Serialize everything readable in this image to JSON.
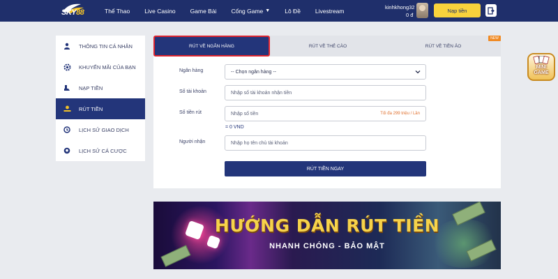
{
  "header": {
    "logo_text_a": "SKY",
    "logo_text_b": "88",
    "nav": [
      {
        "label": "Thể Thao"
      },
      {
        "label": "Live Casino"
      },
      {
        "label": "Game Bài"
      },
      {
        "label": "Cổng Game",
        "has_caret": true
      },
      {
        "label": "Lô Đề"
      },
      {
        "label": "Livestream"
      }
    ],
    "username": "kinhkhong32",
    "balance": "0 đ",
    "deposit_label": "Nạp tiền"
  },
  "sidebar": {
    "items": [
      {
        "label": "THÔNG TIN CÁ NHÂN",
        "icon": "user-icon"
      },
      {
        "label": "KHUYẾN MÃI CỦA BẠN",
        "icon": "gear-icon"
      },
      {
        "label": "NẠP TIỀN",
        "icon": "hand-coin-icon"
      },
      {
        "label": "RÚT TIỀN",
        "icon": "withdraw-icon",
        "active": true
      },
      {
        "label": "LỊCH SỬ GIAO DỊCH",
        "icon": "history-icon"
      },
      {
        "label": "LỊCH SỬ CÁ CƯỢC",
        "icon": "ball-icon"
      }
    ]
  },
  "tabs": [
    {
      "label": "RÚT VỀ NGÂN HÀNG",
      "active": true
    },
    {
      "label": "RÚT VỀ THẺ CÀO"
    },
    {
      "label": "RÚT VỀ TIỀN ẢO"
    }
  ],
  "new_badge": "NEW",
  "form": {
    "bank_label": "Ngân hàng",
    "bank_value": "-- Chọn ngân hàng --",
    "account_label": "Số tài khoản",
    "account_placeholder": "Nhập số tài khoản nhận tiền",
    "amount_label": "Số tiền rút",
    "amount_placeholder": "Nhập số tiền",
    "amount_hint": "Tối đa 299 triệu / Lần",
    "converted": "= 0 VND",
    "recipient_label": "Người nhận",
    "recipient_placeholder": "Nhập họ tên chủ tài khoản",
    "submit_label": "RÚT TIỀN NGAY"
  },
  "banner": {
    "title": "HƯỚNG DẪN RÚT TIỀN",
    "subtitle": "NHANH CHÓNG - BẢO MẬT"
  },
  "minigame": {
    "label_a": "MINI",
    "label_b": "GAME"
  },
  "colors": {
    "header_bg": "#1f2f6b",
    "accent_yellow": "#f8d23c",
    "active_blue": "#23357a",
    "tab_border_red": "#e0252f",
    "badge_orange": "#f08a24"
  }
}
